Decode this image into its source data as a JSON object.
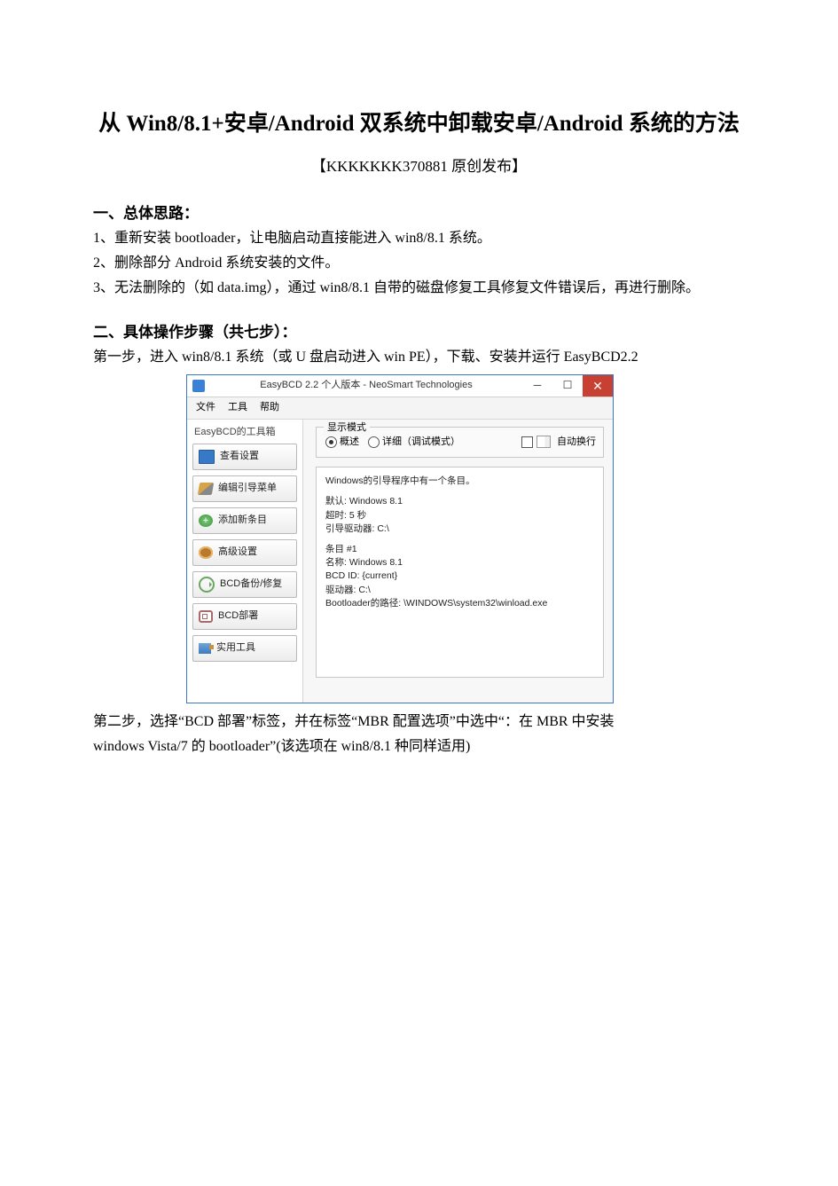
{
  "doc": {
    "title": "从 Win8/8.1+安卓/Android 双系统中卸载安卓/Android 系统的方法",
    "author_line": "【KKKKKKK370881 原创发布】",
    "sec1_head": "一、总体思路：",
    "sec1_l1": "1、重新安装 bootloader，让电脑启动直接能进入 win8/8.1 系统。",
    "sec1_l2": "2、删除部分 Android 系统安装的文件。",
    "sec1_l3": "3、无法删除的（如 data.img），通过 win8/8.1 自带的磁盘修复工具修复文件错误后，再进行删除。",
    "sec2_head": "二、具体操作步骤（共七步）：",
    "sec2_l1": "第一步，进入 win8/8.1 系统（或 U 盘启动进入 win PE），下载、安装并运行 EasyBCD2.2",
    "step2_a": "第二步，选择“BCD 部署”标签，并在标签“MBR 配置选项”中选中“：在 MBR 中安装",
    "step2_b": "windows Vista/7 的 bootloader”(该选项在 win8/8.1 种同样适用)"
  },
  "app": {
    "window_title": "EasyBCD 2.2  个人版本 - NeoSmart Technologies",
    "menubar": [
      "文件",
      "工具",
      "帮助"
    ],
    "sidebar_title": "EasyBCD的工具箱",
    "sidebar": [
      {
        "label": "查看设置"
      },
      {
        "label": "编辑引导菜单"
      },
      {
        "label": "添加新条目"
      },
      {
        "label": "高级设置"
      },
      {
        "label": "BCD备份/修复"
      },
      {
        "label": "BCD部署"
      },
      {
        "label": "实用工具"
      }
    ],
    "group_title": "显示模式",
    "radio_overview": "概述",
    "radio_detail": "详细（调试模式）",
    "checkbox_wrap": "自动换行",
    "details_lines": [
      "Windows的引导程序中有一个条目。",
      "",
      "默认: Windows 8.1",
      "超时: 5 秒",
      "引导驱动器: C:\\",
      "",
      "条目 #1",
      "名称: Windows 8.1",
      "BCD ID: {current}",
      "驱动器: C:\\",
      "Bootloader的路径: \\WINDOWS\\system32\\winload.exe"
    ]
  }
}
